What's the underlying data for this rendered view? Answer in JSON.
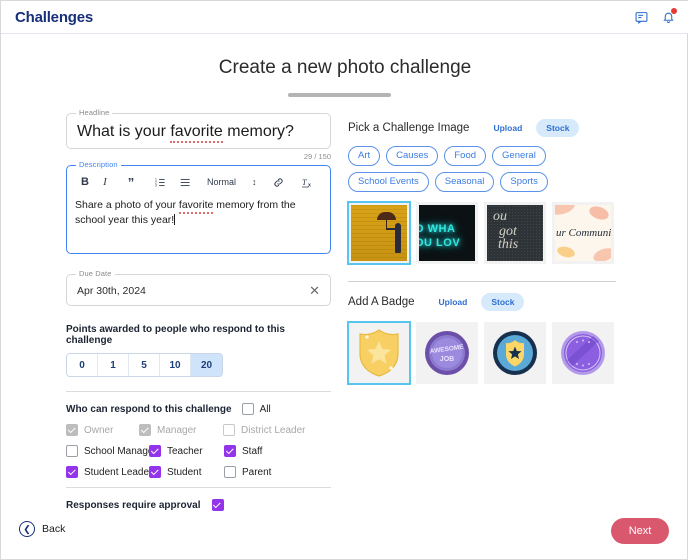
{
  "header": {
    "app_title": "Challenges",
    "messages_icon": "chat-bubble-icon",
    "notifications_icon": "bell-icon",
    "has_notification": true
  },
  "page": {
    "title": "Create a new photo challenge"
  },
  "form": {
    "headline": {
      "legend": "Headline",
      "value_part1": "What is your ",
      "value_misspelled": "favorite",
      "value_part2": " memory?",
      "char_count": "29 / 150"
    },
    "description": {
      "legend": "Description",
      "text_part1": "Share a photo of your ",
      "text_misspelled": "favorite",
      "text_part2": " memory from the school year this year!",
      "toolbar": {
        "bold": "B",
        "italic": "I",
        "quote": "”",
        "ordered_list": "ordered-list-icon",
        "bullet_list": "bullet-list-icon",
        "format": "Normal",
        "format_caret": "↕",
        "link": "link-icon",
        "clear_format": "clear-formatting-icon"
      }
    },
    "due_date": {
      "legend": "Due Date",
      "value": "Apr 30th, 2024",
      "clear": "✕"
    },
    "points": {
      "label": "Points awarded to people who respond to this challenge",
      "options": [
        "0",
        "1",
        "5",
        "10",
        "20"
      ],
      "selected": "20"
    },
    "audience": {
      "label": "Who can respond to this challenge",
      "all_label": "All",
      "all_checked": false,
      "rows": [
        [
          {
            "label": "Owner",
            "checked": true,
            "disabled": true
          },
          {
            "label": "Manager",
            "checked": true,
            "disabled": true
          },
          {
            "label": "District Leader",
            "checked": false,
            "disabled": true
          }
        ],
        [
          {
            "label": "School Manager",
            "checked": false,
            "disabled": false
          },
          {
            "label": "Teacher",
            "checked": true,
            "disabled": false
          },
          {
            "label": "Staff",
            "checked": true,
            "disabled": false
          }
        ],
        [
          {
            "label": "Student Leader",
            "checked": true,
            "disabled": false
          },
          {
            "label": "Student",
            "checked": true,
            "disabled": false
          },
          {
            "label": "Parent",
            "checked": false,
            "disabled": false
          }
        ]
      ]
    },
    "approval": {
      "label": "Responses require approval",
      "checked": true
    }
  },
  "challenge_image": {
    "title": "Pick a Challenge Image",
    "source_options": [
      "Upload",
      "Stock"
    ],
    "source_selected": "Stock",
    "categories": [
      "Art",
      "Causes",
      "Food",
      "General",
      "School Events",
      "Seasonal",
      "Sports"
    ],
    "thumbnails": [
      {
        "name": "umbrella-yellow-wall",
        "selected": true,
        "caption": ""
      },
      {
        "name": "neon-do-what-you-love",
        "selected": false,
        "caption_line1": "O WHA",
        "caption_line2": "OU LOV"
      },
      {
        "name": "chalkboard-you-got-this",
        "selected": false,
        "caption_line1": "ou",
        "caption_line2": "got",
        "caption_line3": "this"
      },
      {
        "name": "our-community-floral",
        "selected": false,
        "caption": "ur Communi"
      }
    ]
  },
  "badge": {
    "title": "Add A Badge",
    "source_options": [
      "Upload",
      "Stock"
    ],
    "source_selected": "Stock",
    "items": [
      {
        "name": "gold-star-shield-badge",
        "selected": true,
        "text": ""
      },
      {
        "name": "awesome-job-purple-badge",
        "selected": false,
        "text_line1": "AWESOME",
        "text_line2": "JOB"
      },
      {
        "name": "blue-star-shield-badge",
        "selected": false,
        "text": ""
      },
      {
        "name": "purple-ribbon-badge",
        "selected": false,
        "text": ""
      }
    ]
  },
  "footer": {
    "back_label": "Back",
    "back_icon": "chevron-left-icon",
    "next_label": "Next"
  },
  "colors": {
    "brand_navy": "#17307a",
    "accent_blue": "#3b7ce0",
    "checkbox_purple": "#9333ea",
    "next_button": "#d9586e",
    "selection_outline": "#56c6ee"
  }
}
